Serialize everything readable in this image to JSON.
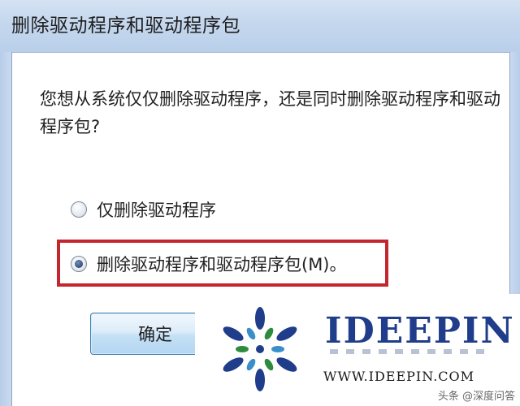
{
  "dialog": {
    "title": "删除驱动程序和驱动程序包",
    "question": "您想从系统仅仅删除驱动程序，还是同时删除驱动程序和驱动程序包?",
    "options": [
      {
        "label": "仅删除驱动程序",
        "checked": false
      },
      {
        "label": "删除驱动程序和驱动程序包(M)。",
        "checked": true
      }
    ],
    "ok_label": "确定",
    "highlight_color": "#c4262e"
  },
  "watermark": {
    "brand": "IDEEPIN",
    "url": "WWW.IDEEPIN.COM",
    "credit": "头条 @深度问答"
  }
}
